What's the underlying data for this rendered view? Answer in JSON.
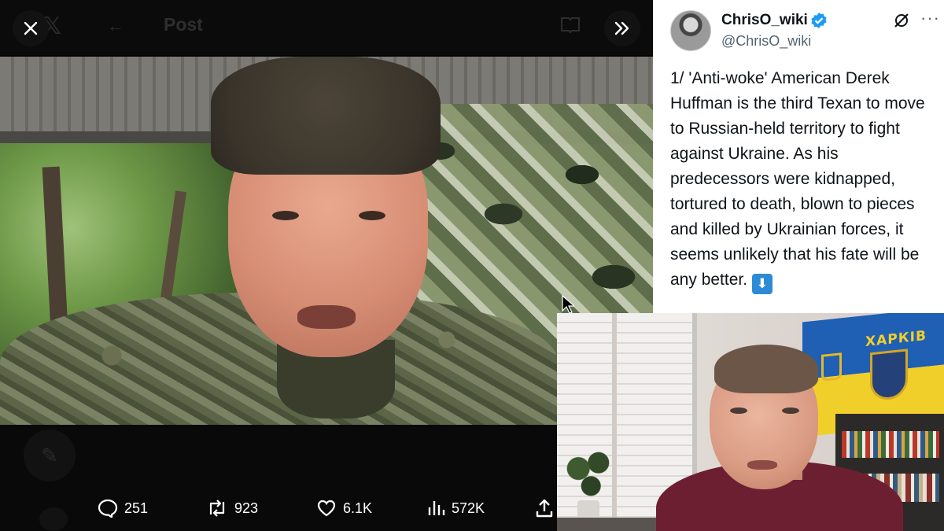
{
  "viewer": {
    "top_bar": {
      "title": "Post"
    },
    "actions": [
      {
        "name": "reply",
        "icon": "comment-icon",
        "count": "251"
      },
      {
        "name": "repost",
        "icon": "repost-icon",
        "count": "923"
      },
      {
        "name": "like",
        "icon": "heart-icon",
        "count": "6.1K"
      },
      {
        "name": "views",
        "icon": "analytics-icon",
        "count": "572K"
      },
      {
        "name": "share",
        "icon": "share-icon",
        "count": ""
      }
    ]
  },
  "tweet": {
    "display_name": "ChrisO_wiki",
    "handle": "@ChrisO_wiki",
    "text": "1/ 'Anti-woke' American Derek Huffman is the third Texan to move to Russian-held territory to fight against Ukraine. As his predecessors were kidnapped, tortured to death, blown to pieces and killed by Ukrainian forces, it seems unlikely that his fate will be any better.",
    "emoji": "⬇",
    "verified_color": "#1d9bf0"
  },
  "webcam": {
    "flag_text": "ХАРКІВ"
  },
  "colors": {
    "viewer_bg": "#000000",
    "tweet_bg": "#ffffff",
    "action_text": "#ffffff"
  }
}
